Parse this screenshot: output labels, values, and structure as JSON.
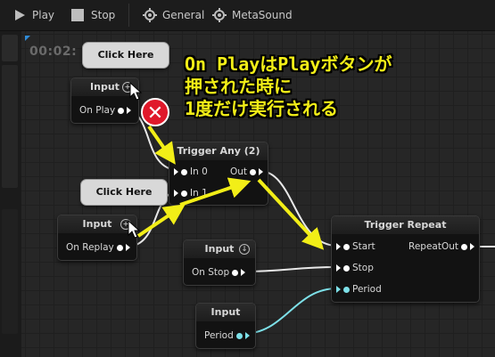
{
  "toolbar": {
    "play_label": "Play",
    "stop_label": "Stop",
    "general_label": "General",
    "metasound_label": "MetaSound"
  },
  "graph": {
    "time_display": "00:02:",
    "nodes": {
      "input_play": {
        "title": "Input",
        "pin": "On Play"
      },
      "input_replay": {
        "title": "Input",
        "pin": "On Replay"
      },
      "input_stop": {
        "title": "Input",
        "pin": "On Stop"
      },
      "input_period": {
        "title": "Input",
        "pin": "Period"
      },
      "trigger_any": {
        "title": "Trigger Any (2)",
        "in0": "In 0",
        "in1": "In 1",
        "out": "Out"
      },
      "trigger_repeat": {
        "title": "Trigger Repeat",
        "start": "Start",
        "stop": "Stop",
        "period": "Period",
        "repeat_out": "RepeatOut"
      }
    },
    "bubbles": {
      "top": "Click Here",
      "bottom": "Click Here"
    }
  },
  "annotation": {
    "line1": "On PlayはPlayボタンが",
    "line2": "押された時に",
    "line3": "1度だけ実行される"
  },
  "colors": {
    "arrow": "#f2ee17",
    "cross": "#e0182a",
    "period_pin": "#7de0e8"
  }
}
